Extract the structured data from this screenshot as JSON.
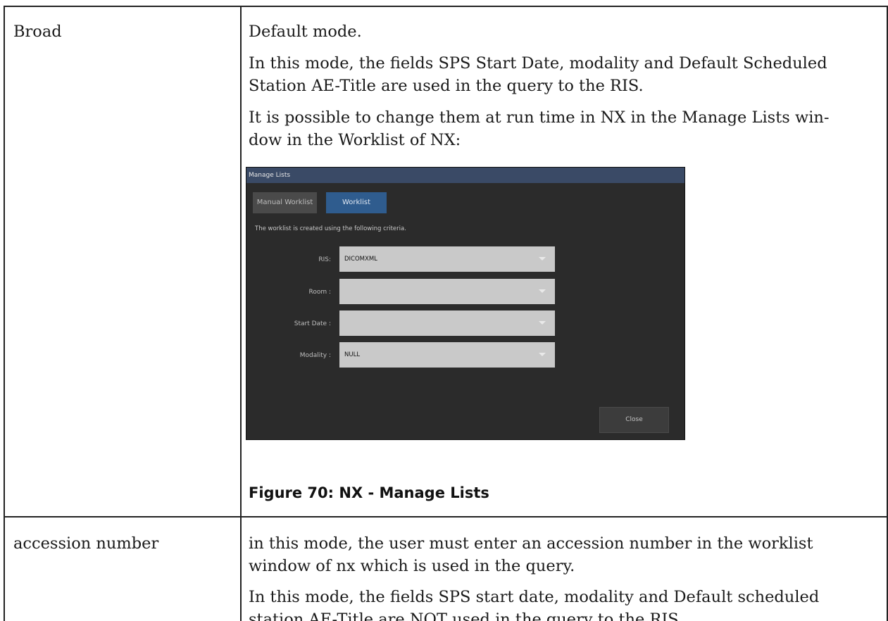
{
  "rows": [
    {
      "term": "Broad",
      "paragraphs": [
        "Default mode.",
        "In this mode, the fields SPS Start Date, modality and Default Scheduled",
        "Station AE-Title are used in the query to the RIS.",
        "It is possible to change them at run time in NX in the Manage Lists win-",
        "dow in the Worklist of NX:"
      ],
      "caption": "Figure 70: NX - Manage Lists"
    },
    {
      "term": "accession number",
      "paragraphs": [
        "in this mode, the user must enter an accession number in the worklist",
        "window of nx which is used in the query.",
        "In this mode, the fields SPS start date, modality and Default scheduled",
        "station AE-Title are NOT used in the query to the RIS."
      ]
    }
  ],
  "screenshot": {
    "window_title": "Manage Lists",
    "tabs": {
      "manual": "Manual Worklist",
      "worklist": "Worklist"
    },
    "info_text": "The worklist is created using the following criteria.",
    "fields": {
      "ris": {
        "label": "RIS:",
        "value": "DICOMXML"
      },
      "room": {
        "label": "Room :",
        "value": ""
      },
      "start_date": {
        "label": "Start Date :",
        "value": ""
      },
      "modality": {
        "label": "Modality :",
        "value": "NULL"
      }
    },
    "close_button": "Close",
    "colors": {
      "window_bg": "#2b2b2b",
      "titlebar": "#3a4a66",
      "active_tab": "#2f5c8e",
      "field_bg": "#c9c9c9"
    }
  }
}
